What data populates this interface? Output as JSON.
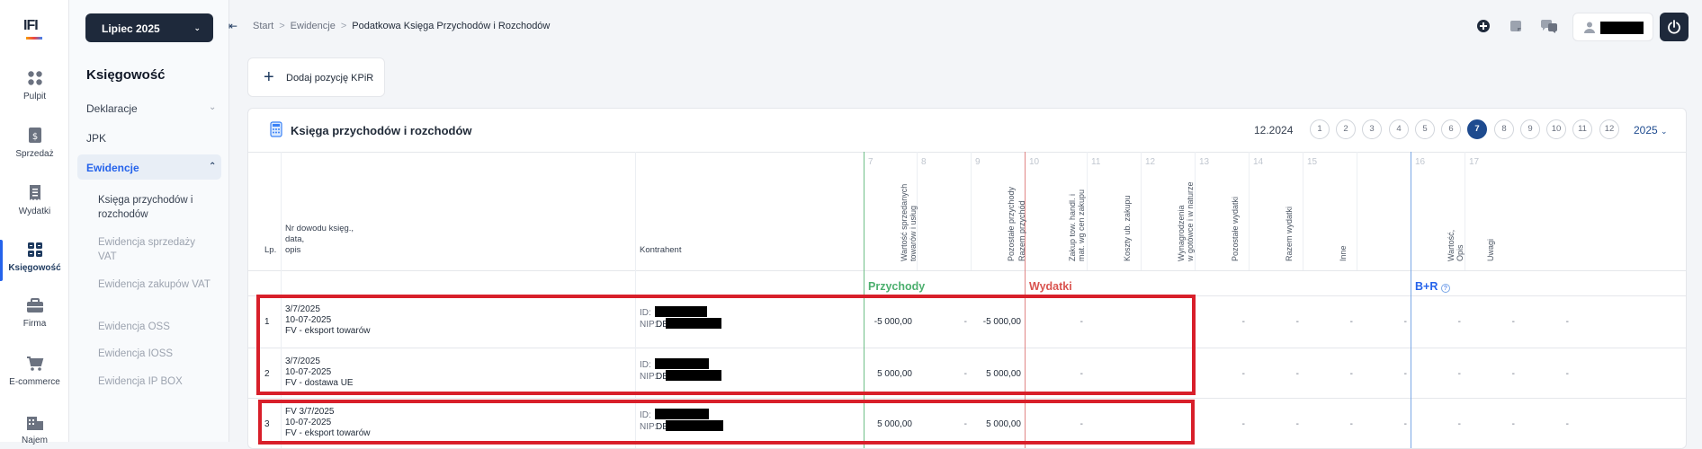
{
  "rail": {
    "logo": "IFI",
    "items": [
      {
        "label": "Pulpit",
        "icon": "dashboard-icon"
      },
      {
        "label": "Sprzedaż",
        "icon": "sales-document-icon"
      },
      {
        "label": "Wydatki",
        "icon": "receipt-icon"
      },
      {
        "label": "Księgowość",
        "icon": "accounting-grid-icon"
      },
      {
        "label": "Firma",
        "icon": "briefcase-icon"
      },
      {
        "label": "E-commerce",
        "icon": "cart-icon"
      },
      {
        "label": "Najem",
        "icon": "building-icon"
      }
    ]
  },
  "panel": {
    "month": "Lipiec 2025",
    "title": "Księgowość",
    "nav": [
      "Deklaracje",
      "JPK",
      "Ewidencje"
    ],
    "sub": [
      "Księga przychodów i rozchodów",
      "Ewidencja sprzedaży VAT",
      "Ewidencja zakupów VAT",
      "Ewidencja OSS",
      "Ewidencja IOSS",
      "Ewidencja IP BOX"
    ]
  },
  "breadcrumb": [
    "Start",
    "Ewidencje",
    "Podatkowa Księga Przychodów i Rozchodów"
  ],
  "add_button": "Dodaj pozycję KPiR",
  "card": {
    "title": "Księga przychodów i rozchodów",
    "prev_month": "12.2024",
    "months": [
      "1",
      "2",
      "3",
      "4",
      "5",
      "6",
      "7",
      "8",
      "9",
      "10",
      "11",
      "12"
    ],
    "selected_month": "7",
    "year": "2025"
  },
  "columns": {
    "lp": "Lp.",
    "doc": "Nr dowodu księg.,\ndata,\nopis",
    "contractor": "Kontrahent",
    "numbered": [
      {
        "n": "7",
        "label": "Wartość sprzedanych\ntowarów i usług"
      },
      {
        "n": "8",
        "label": ""
      },
      {
        "n": "9",
        "label": "Pozostałe przychody"
      },
      {
        "n": "",
        "label": "Razem przychód"
      },
      {
        "n": "10",
        "label": "Zakup tow. handl. i\nmat. wg cen zakupu"
      },
      {
        "n": "11",
        "label": "Koszty ub. zakupu"
      },
      {
        "n": "12",
        "label": "Wynagrodzenia\nw gotówce i w naturze"
      },
      {
        "n": "13",
        "label": "Pozostałe wydatki"
      },
      {
        "n": "14",
        "label": "Razem wydatki"
      },
      {
        "n": "15",
        "label": "Inne"
      },
      {
        "n": "16",
        "label": "Wartość,\nOpis"
      },
      {
        "n": "17",
        "label": "Uwagi"
      }
    ]
  },
  "sections": {
    "income": "Przychody",
    "expenses": "Wydatki",
    "br": "B+R"
  },
  "colors": {
    "income": "#4caf6e",
    "expenses": "#d9534f",
    "br": "#2563eb",
    "highlight": "#d81f2a",
    "navy": "#1e293b"
  },
  "rows": [
    {
      "lp": "1",
      "doc": "3/7/2025",
      "date": "10-07-2025",
      "desc": "FV - eksport towarów",
      "id_label": "ID:",
      "nip_label": "NIP:",
      "nip_prefix": "DE",
      "sales": "-5 000,00",
      "other": "-",
      "total": "-5 000,00"
    },
    {
      "lp": "2",
      "doc": "3/7/2025",
      "date": "10-07-2025",
      "desc": "FV - dostawa UE",
      "id_label": "ID:",
      "nip_label": "NIP:",
      "nip_prefix": "DE",
      "sales": "5 000,00",
      "other": "-",
      "total": "5 000,00"
    },
    {
      "lp": "3",
      "doc": "FV 3/7/2025",
      "date": "10-07-2025",
      "desc": "FV - eksport towarów",
      "id_label": "ID:",
      "nip_label": "NIP:",
      "nip_prefix": "DE",
      "sales": "5 000,00",
      "other": "-",
      "total": "5 000,00"
    }
  ],
  "dash": "-"
}
